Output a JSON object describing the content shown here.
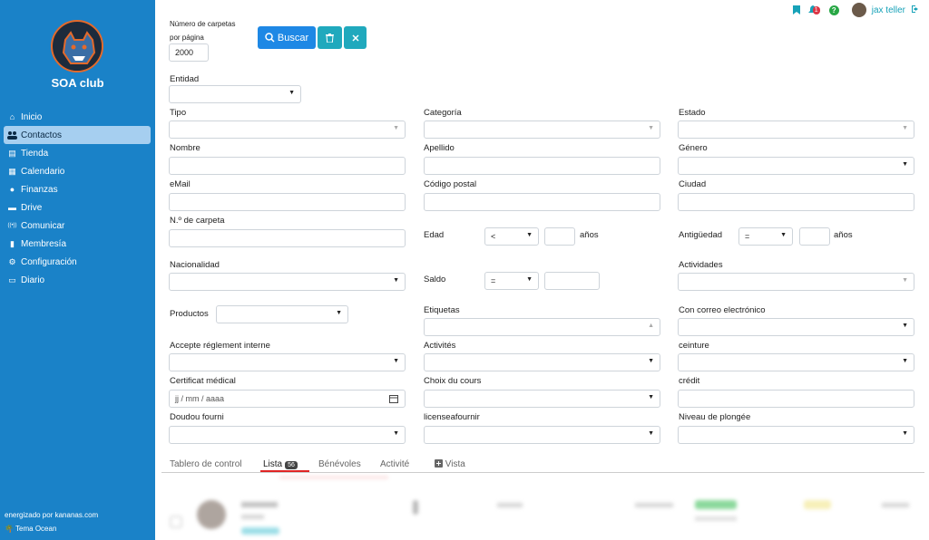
{
  "sidebar": {
    "club_name": "SOA club",
    "items": [
      {
        "label": "Inicio",
        "icon": "home-icon",
        "glyph": "⌂"
      },
      {
        "label": "Contactos",
        "icon": "users-icon",
        "glyph": "👥"
      },
      {
        "label": "Tienda",
        "icon": "store-icon",
        "glyph": "▤"
      },
      {
        "label": "Calendario",
        "icon": "calendar-icon",
        "glyph": "▦"
      },
      {
        "label": "Finanzas",
        "icon": "piggy-bank-icon",
        "glyph": "●"
      },
      {
        "label": "Drive",
        "icon": "drive-icon",
        "glyph": "▬"
      },
      {
        "label": "Comunicar",
        "icon": "broadcast-icon",
        "glyph": "((•))"
      },
      {
        "label": "Membresía",
        "icon": "membership-icon",
        "glyph": "▮"
      },
      {
        "label": "Configuración",
        "icon": "gear-icon",
        "glyph": "⚙"
      },
      {
        "label": "Diario",
        "icon": "journal-icon",
        "glyph": "▭"
      }
    ],
    "powered_by": "energizado por kananas.com",
    "theme": "Tema Ocean"
  },
  "topbar": {
    "notifications_count": "1",
    "help": "?",
    "username": "jax teller"
  },
  "filters": {
    "per_page_label_1": "Número de carpetas",
    "per_page_label_2": "por página",
    "per_page_value": "2000",
    "search_button": "Buscar",
    "entity_label": "Entidad",
    "type_label": "Tipo",
    "category_label": "Categoría",
    "status_label": "Estado",
    "name_label": "Nombre",
    "surname_label": "Apellido",
    "gender_label": "Género",
    "email_label": "eMail",
    "postal_label": "Código postal",
    "city_label": "Ciudad",
    "folder_no_label": "N.º de carpeta",
    "age_label": "Edad",
    "age_operator": "<",
    "years_label": "años",
    "seniority_label": "Antigüedad",
    "seniority_operator": "=",
    "years_label_2": "años",
    "nationality_label": "Nacionalidad",
    "balance_label": "Saldo",
    "balance_operator": "=",
    "activities_label": "Actividades",
    "products_label": "Productos",
    "tags_label": "Etiquetas",
    "with_email_label": "Con correo electrónico",
    "rules_label": "Accepte réglement interne",
    "activites_label": "Activités",
    "belt_label": "ceinture",
    "medical_label": "Certificat médical",
    "date_placeholder": "jj / mm / aaaa",
    "course_label": "Choix du cours",
    "credit_label": "crédit",
    "doudou_label": "Doudou fourni",
    "license_label": "licenseafournir",
    "dive_label": "Niveau de plongée"
  },
  "tabs": {
    "dashboard": "Tablero de control",
    "list": "Lista",
    "list_count": "56",
    "volunteers": "Bénévoles",
    "activity": "Activité",
    "view": "Vista"
  },
  "colors": {
    "sidebar": "#1a82c8",
    "primary": "#1e88e5",
    "info": "#20a9bd",
    "accent_red": "#e02424"
  }
}
